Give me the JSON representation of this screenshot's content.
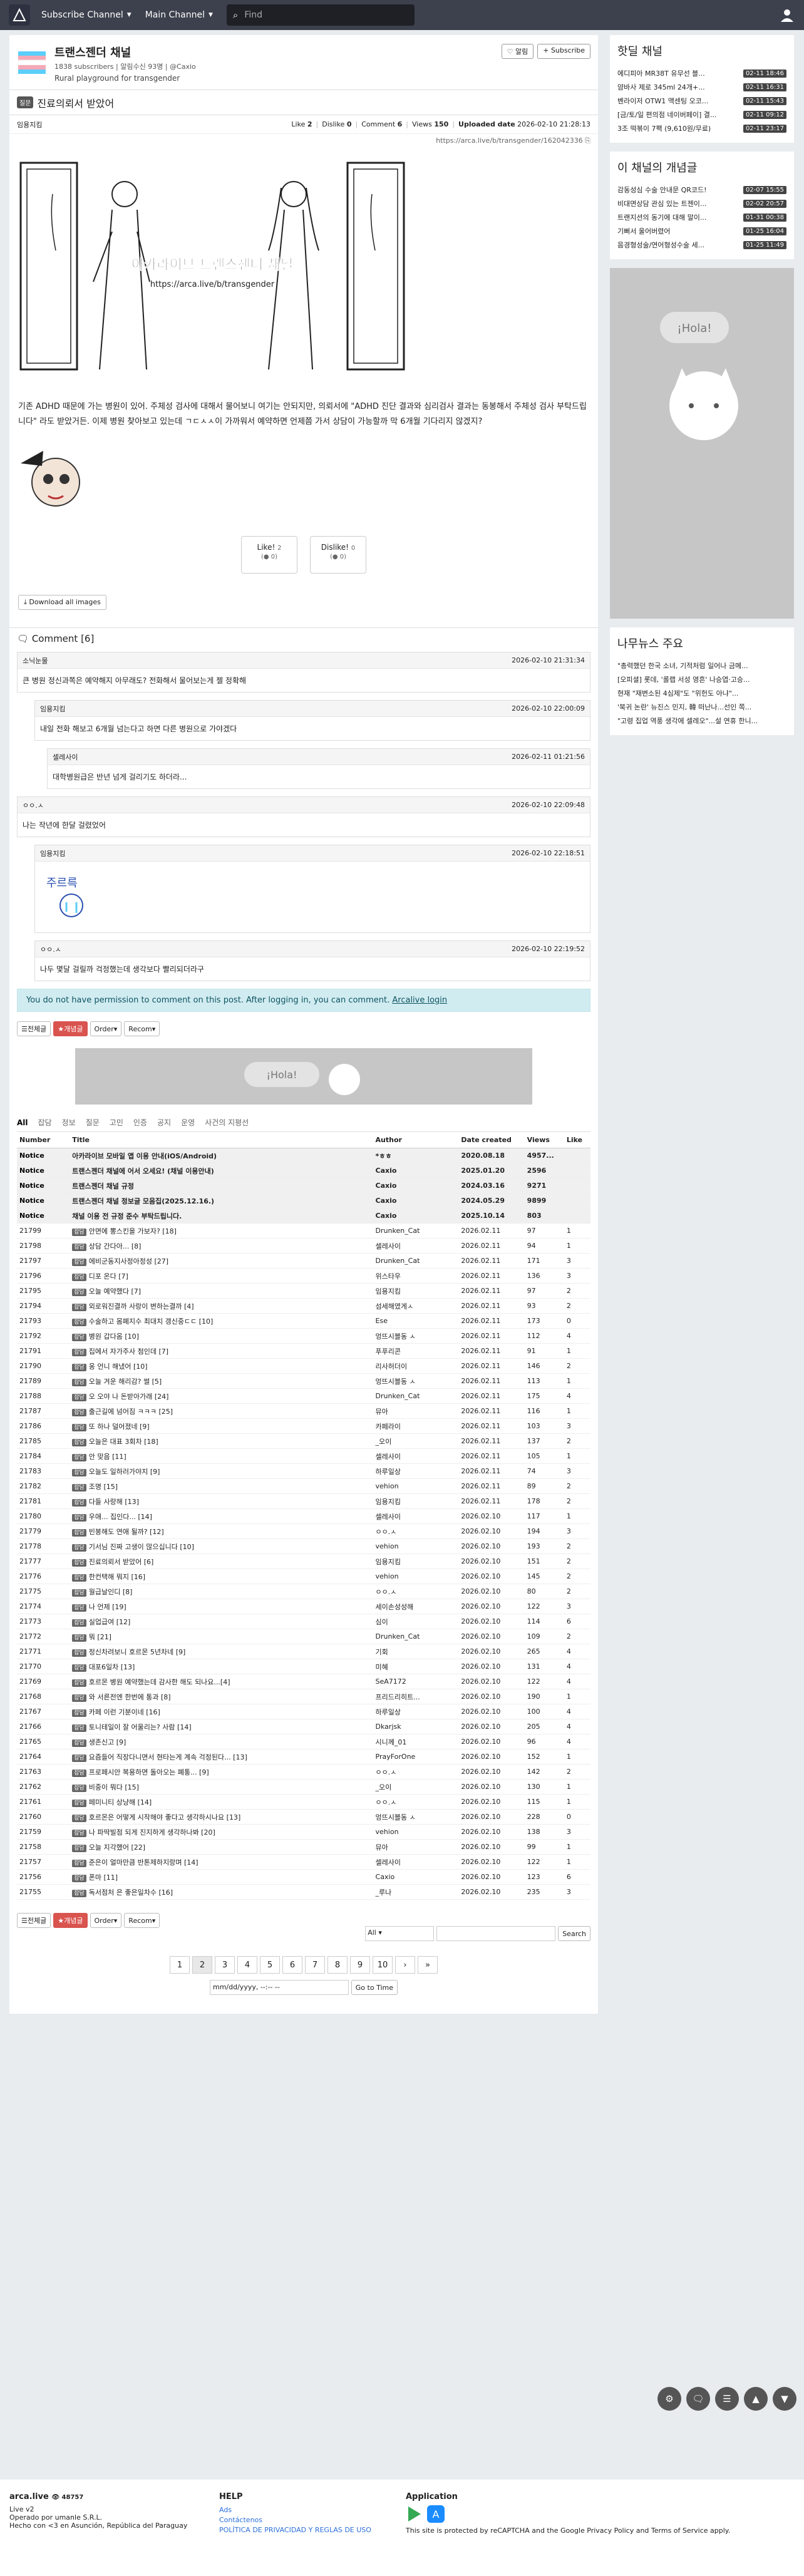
{
  "nav": {
    "subscribe_channel": "Subscribe Channel",
    "main_channel": "Main Channel",
    "search_placeholder": "Find"
  },
  "channel": {
    "title": "트랜스젠더 채널",
    "subscribers": "1838 subscribers",
    "notifications": "알림수신 93명",
    "owner": "@Caxio",
    "description": "Rural playground for transgender",
    "alert_btn": "알림",
    "subscribe_btn": "Subscribe"
  },
  "post": {
    "category": "질문",
    "title": "진료의뢰서 받았어",
    "author": "임용지킴",
    "like_label": "Like",
    "like_value": "2",
    "dislike_label": "Dislike",
    "dislike_value": "0",
    "comment_label": "Comment",
    "comment_value": "6",
    "views_label": "Views",
    "views_value": "150",
    "uploaded_label": "Uploaded date",
    "uploaded_value": "2026-02-10 21:28:13",
    "url": "https://arca.live/b/transgender/162042336",
    "image_caption": "아카라이브 트랜스젠더 채널",
    "image_subcaption": "https://arca.live/b/transgender",
    "body_text": "기존 ADHD 때문에 가는 병원이 있어. 주체성 검사에 대해서 물어보니 여기는 안되지만, 의뢰서에 \"ADHD 진단 결과와 심리검사 결과는 동봉해서 주체성 검사 부탁드립니다\" 라도 받았거든. 이제 병원 찾아보고 있는데 ㄱㄷㅅㅅ이 가까워서 예약하면 언제쯤 가서 상담이 가능할까 막 6개월 기다리지 않겠지?",
    "vote_like": "Like!",
    "vote_like_count": "2",
    "vote_like_sub": "(● 0)",
    "vote_dislike": "Dislike!",
    "vote_dislike_count": "0",
    "vote_dislike_sub": "(● 0)",
    "download_all": "Download all images"
  },
  "comments_header": "Comment [6]",
  "comments": [
    {
      "user": "소닉눈물",
      "time": "2026-02-10 21:31:34",
      "text": "큰 병원 정신과쪽은 예약해지 아무래도? 전화해서 물어보는게 젤 정확해"
    },
    {
      "user": "임용지킴",
      "time": "2026-02-10 22:00:09",
      "text": "내일 전화 해보고 6개월 넘는다고 하면 다른 병원으로 가야겠다"
    },
    {
      "user": "셀레사이",
      "time": "2026-02-11 01:21:56",
      "text": "대학병원급은 반년 넘게 걸리기도 하더라..."
    },
    {
      "user": "ㅇㅇ.ㅅ",
      "time": "2026-02-10 22:09:48",
      "text": "나는 작년에 한달 걸렸었어"
    },
    {
      "user": "임용지킴",
      "time": "2026-02-10 22:18:51",
      "text": ""
    },
    {
      "user": "ㅇㅇ.ㅅ",
      "time": "2026-02-10 22:19:52",
      "text": "나두 몇달 걸릴까 걱정했는데 생각보다 빨리되더라구"
    }
  ],
  "permission_msg": "You do not have permission to comment on this post. After logging in, you can comment.",
  "login_link": "Arcalive login",
  "toolbar": {
    "all": "전체글",
    "best": "개념글",
    "order": "Order",
    "recom": "Recom"
  },
  "tabs": [
    "All",
    "잡담",
    "정보",
    "질문",
    "고민",
    "인증",
    "공지",
    "운영",
    "사건의 지평선"
  ],
  "table_headers": [
    "Number",
    "Title",
    "Author",
    "Date created",
    "Views",
    "Like"
  ],
  "notices": [
    {
      "num": "Notice",
      "title": "아카라이브 모바일 앱 이용 안내(iOS/Android)",
      "author": "*ㅎㅎ",
      "date": "2020.08.18",
      "views": "4957...",
      "like": ""
    },
    {
      "num": "Notice",
      "title": "트랜스젠더 채널에 어서 오세요! (채널 이용안내)",
      "author": "Caxio",
      "date": "2025.01.20",
      "views": "2596",
      "like": ""
    },
    {
      "num": "Notice",
      "title": "트랜스젠더 채널 규정",
      "author": "Caxio",
      "date": "2024.03.16",
      "views": "9271",
      "like": ""
    },
    {
      "num": "Notice",
      "title": "트랜스젠더 채널 정보글 모음집(2025.12.16.)",
      "author": "Caxio",
      "date": "2024.05.29",
      "views": "9899",
      "like": ""
    },
    {
      "num": "Notice",
      "title": "채널 이용 전 규정 준수 부탁드립니다.",
      "author": "Caxio",
      "date": "2025.10.14",
      "views": "803",
      "like": ""
    }
  ],
  "rows": [
    [
      "21799",
      "잡담",
      "안면에 뽕스킨을 가보자? [18]",
      "Drunken_Cat",
      "2026.02.11",
      "97",
      "1"
    ],
    [
      "21798",
      "잡담",
      "상담 간다아... [8]",
      "셀레사이",
      "2026.02.11",
      "94",
      "1"
    ],
    [
      "21797",
      "잡담",
      "에비군동지사정아정성 [27]",
      "Drunken_Cat",
      "2026.02.11",
      "171",
      "3"
    ],
    [
      "21796",
      "잡담",
      "디포 온다 [7]",
      "위스타우",
      "2026.02.11",
      "136",
      "3"
    ],
    [
      "21795",
      "잡담",
      "오늘 예약했다 [7]",
      "임용지킴",
      "2026.02.11",
      "97",
      "2"
    ],
    [
      "21794",
      "잡담",
      "외로워진결까 사랑이 변하는결까 [4]",
      "섬세해였게ㅅ",
      "2026.02.11",
      "93",
      "2"
    ],
    [
      "21793",
      "잡담",
      "수술하고 몸폐지수 최대치 갱신중ㄷㄷ [10]",
      "Ese",
      "2026.02.11",
      "173",
      "0"
    ],
    [
      "21792",
      "잡담",
      "병원 갑다옴 [10]",
      "엉뜨시블동 ㅅ",
      "2026.02.11",
      "112",
      "4"
    ],
    [
      "21791",
      "잡담",
      "집에서 자가주사 첨인데 [7]",
      "푸푸리콘",
      "2026.02.11",
      "91",
      "1"
    ],
    [
      "21790",
      "잡담",
      "옹 언니 해냈어 [10]",
      "리사허더이",
      "2026.02.11",
      "146",
      "2"
    ],
    [
      "21789",
      "잡담",
      "오늘 겨운 해리감? 썰 [5]",
      "엉뜨시블동 ㅅ",
      "2026.02.11",
      "113",
      "1"
    ],
    [
      "21788",
      "잡담",
      "오 오야 나 돈받아가래 [24]",
      "Drunken_Cat",
      "2026.02.11",
      "175",
      "4"
    ],
    [
      "21787",
      "잡담",
      "출근길에 넘어짐 ㅋㅋㅋ [25]",
      "뮤아",
      "2026.02.11",
      "116",
      "1"
    ],
    [
      "21786",
      "잡담",
      "또 하나 덜어졌네 [9]",
      "카페라이",
      "2026.02.11",
      "103",
      "3"
    ],
    [
      "21785",
      "잡담",
      "오늘은 대표 3회차 [18]",
      "_오이",
      "2026.02.11",
      "137",
      "2"
    ],
    [
      "21784",
      "잡담",
      "안 맞음 [11]",
      "셀레사이",
      "2026.02.11",
      "105",
      "1"
    ],
    [
      "21783",
      "잡담",
      "오늘도 일하러가야지 [9]",
      "하루일상",
      "2026.02.11",
      "74",
      "3"
    ],
    [
      "21782",
      "잡담",
      "조명 [15]",
      "vehion",
      "2026.02.11",
      "89",
      "2"
    ],
    [
      "21781",
      "잡담",
      "다들 사랑해 [13]",
      "임용지킴",
      "2026.02.11",
      "178",
      "2"
    ],
    [
      "21780",
      "잡담",
      "우애... 집인다... [14]",
      "셀레사이",
      "2026.02.10",
      "117",
      "1"
    ],
    [
      "21779",
      "잡담",
      "빈봉해도 연애 될까? [12]",
      "ㅇㅇ.ㅅ",
      "2026.02.10",
      "194",
      "3"
    ],
    [
      "21778",
      "잡담",
      "기서님 진짜 고생이 많으십니다 [10]",
      "vehion",
      "2026.02.10",
      "193",
      "2"
    ],
    [
      "21777",
      "잡담",
      "진료의뢰서 받았어 [6]",
      "임용지킴",
      "2026.02.10",
      "151",
      "2"
    ],
    [
      "21776",
      "잡담",
      "한컨택해 뭐지 [16]",
      "vehion",
      "2026.02.10",
      "145",
      "2"
    ],
    [
      "21775",
      "잡담",
      "월급날인디 [8]",
      "ㅇㅇ.ㅅ",
      "2026.02.10",
      "80",
      "2"
    ],
    [
      "21774",
      "잡담",
      "나 언제 [19]",
      "세이손성성해",
      "2026.02.10",
      "122",
      "3"
    ],
    [
      "21773",
      "잡담",
      "실업급여 [12]",
      "심이",
      "2026.02.10",
      "114",
      "6"
    ],
    [
      "21772",
      "잡담",
      "뭐 [21]",
      "Drunken_Cat",
      "2026.02.10",
      "109",
      "2"
    ],
    [
      "21771",
      "잡담",
      "정신차려보니 호르몬 5년차네 [9]",
      "기회",
      "2026.02.10",
      "265",
      "4"
    ],
    [
      "21770",
      "잡담",
      "대포6일차 [13]",
      "미혜",
      "2026.02.10",
      "131",
      "4"
    ],
    [
      "21769",
      "잡담",
      "호르몬 병원 예약했는데 감사한 해도 되나요...[4]",
      "SeA7172",
      "2026.02.10",
      "122",
      "4"
    ],
    [
      "21768",
      "잡담",
      "와 서른전엔 한번에 통과 [8]",
      "프리드리히트...",
      "2026.02.10",
      "190",
      "1"
    ],
    [
      "21767",
      "잡담",
      "카페 이런 기분이네 [16]",
      "하루일상",
      "2026.02.10",
      "100",
      "4"
    ],
    [
      "21766",
      "잡담",
      "토니테일이 잘 어울리는? 사람 [14]",
      "Dkarjsk",
      "2026.02.10",
      "205",
      "4"
    ],
    [
      "21765",
      "잡담",
      "생존신고 [9]",
      "시니께_01",
      "2026.02.10",
      "96",
      "4"
    ],
    [
      "21764",
      "잡담",
      "요즘들어 직장다니면서 현타는게 계속 걱정된다... [13]",
      "PrayForOne",
      "2026.02.10",
      "152",
      "1"
    ],
    [
      "21763",
      "잡담",
      "프로페시안 복용하면 돌아오는 폐통... [9]",
      "ㅇㅇ.ㅅ",
      "2026.02.10",
      "142",
      "2"
    ],
    [
      "21762",
      "잡담",
      "비중이 뭐다 [15]",
      "_오이",
      "2026.02.10",
      "130",
      "1"
    ],
    [
      "21761",
      "잡담",
      "페미니티 상냥해 [14]",
      "ㅇㅇ.ㅅ",
      "2026.02.10",
      "115",
      "1"
    ],
    [
      "21760",
      "잡담",
      "호르몬은 어떻게 시작해야 좋다고 생각하시나요 [13]",
      "엉뜨시블동 ㅅ",
      "2026.02.10",
      "228",
      "0"
    ],
    [
      "21759",
      "잡담",
      "나 파딱빌점 되게 진지하게 생각하나봐 [20]",
      "vehion",
      "2026.02.10",
      "138",
      "3"
    ],
    [
      "21758",
      "잡담",
      "오늘 지각했어 [22]",
      "뮤아",
      "2026.02.10",
      "99",
      "1"
    ],
    [
      "21757",
      "잡담",
      "준은이 얼마만큼 반톤제하지랑며 [14]",
      "셀레사이",
      "2026.02.10",
      "122",
      "1"
    ],
    [
      "21756",
      "잡담",
      "폰마 [11]",
      "Caxio",
      "2026.02.10",
      "123",
      "6"
    ],
    [
      "21755",
      "잡담",
      "독서점처 은 좋은일차수 [16]",
      "_루나",
      "2026.02.10",
      "235",
      "3"
    ]
  ],
  "pagination": [
    "1",
    "2",
    "3",
    "4",
    "5",
    "6",
    "7",
    "8",
    "9",
    "10"
  ],
  "bottom_search": {
    "scope": "All",
    "button": "Search",
    "date_placeholder": "mm/dd/yyyy, --:-- --",
    "goto": "Go to Time"
  },
  "sidebar": {
    "hot_title": "핫딜 채널",
    "hot": [
      {
        "t": "에디피아 MR38T 유무선 블...",
        "time": "02-11 18:46"
      },
      {
        "t": "얌바사 제로 345ml 24개+...",
        "time": "02-11 16:31"
      },
      {
        "t": "벤라이저 OTW1 액센팅 오코...",
        "time": "02-11 15:43"
      },
      {
        "t": "[금/토/일 편의점 네이버페이] 결...",
        "time": "02-11 09:12"
      },
      {
        "t": "3조 떡볶이 7팩 (9,610원/무료)",
        "time": "02-11 23:17"
      }
    ],
    "best_title": "이 채널의 개념글",
    "best": [
      {
        "t": "감동성심 수술 안내문 QR코드!",
        "time": "02-07 15:55"
      },
      {
        "t": "비대면상담 관심 있는 트젠이...",
        "time": "02-02 20:57"
      },
      {
        "t": "트랜지션의 동기에 대해 말이...",
        "time": "01-31 00:38"
      },
      {
        "t": "기뻐서 울어버렸어",
        "time": "01-25 16:04"
      },
      {
        "t": "음경형성술/연어형성수술 세...",
        "time": "01-25 11:49"
      }
    ],
    "ad_text": "¡Hola!",
    "news_title": "나무뉴스 주요",
    "news": [
      "\"총력했던 한국 소녀, 기적처럼 일어나 금메...",
      "[오피셜] 롯데, '롤랩 서성 영흔' 나승엽·고승...",
      "현재 \"재변소된 4심제\"도 \"위헌도 아냐\"...",
      "'북귀 논란' 뉴진스 민지, 韓 떠난나...선인 쪽...",
      "\"고령 집업 역풍 생각에 셀레오\"...설 연휴 한니..."
    ]
  },
  "footer": {
    "brand": "arca.live",
    "views": "48757",
    "version": "Live v2",
    "operated": "Operado por umanle S.R.L.",
    "made": "Hecho con <3 en Asunción, República del Paraguay",
    "help_title": "HELP",
    "help_links": [
      "Ads",
      "Contáctenos",
      "POLÍTICA DE PRIVACIDAD Y REGLAS DE USO"
    ],
    "app_title": "Application",
    "recaptcha": "This site is protected by reCAPTCHA and the Google Privacy Policy and Terms of Service apply."
  }
}
